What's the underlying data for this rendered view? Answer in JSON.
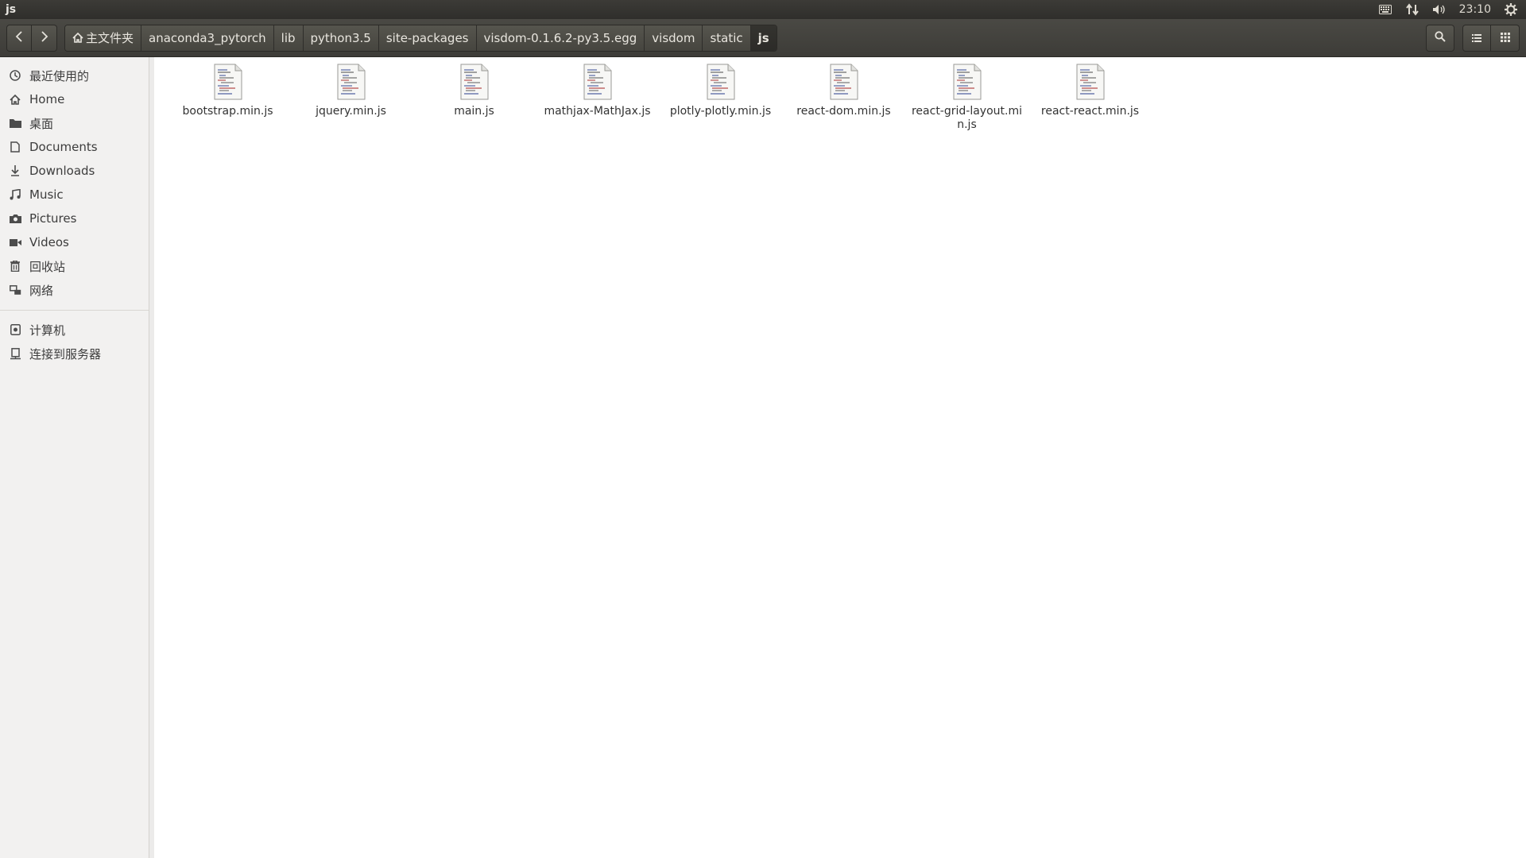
{
  "window": {
    "title": "js"
  },
  "tray": {
    "keyboard_icon": "keyboard-icon",
    "network_icon": "network-arrows-icon",
    "volume_icon": "volume-icon",
    "clock": "23:10",
    "settings_icon": "gear-icon"
  },
  "toolbar": {
    "back_icon": "chevron-left-icon",
    "forward_icon": "chevron-right-icon",
    "breadcrumbs": [
      {
        "label": "主文件夹"
      },
      {
        "label": "anaconda3_pytorch"
      },
      {
        "label": "lib"
      },
      {
        "label": "python3.5"
      },
      {
        "label": "site-packages"
      },
      {
        "label": "visdom-0.1.6.2-py3.5.egg"
      },
      {
        "label": "visdom"
      },
      {
        "label": "static"
      },
      {
        "label": "js"
      }
    ],
    "search_icon": "search-icon",
    "list_view_icon": "list-view-icon",
    "grid_view_icon": "grid-view-icon"
  },
  "sidebar": {
    "items": [
      {
        "label": "最近使用的",
        "icon": "clock-icon"
      },
      {
        "label": "Home",
        "icon": "home-icon"
      },
      {
        "label": "桌面",
        "icon": "folder-icon"
      },
      {
        "label": "Documents",
        "icon": "document-icon"
      },
      {
        "label": "Downloads",
        "icon": "download-icon"
      },
      {
        "label": "Music",
        "icon": "music-icon"
      },
      {
        "label": "Pictures",
        "icon": "camera-icon"
      },
      {
        "label": "Videos",
        "icon": "video-icon"
      },
      {
        "label": "回收站",
        "icon": "trash-icon"
      },
      {
        "label": "网络",
        "icon": "network-icon"
      }
    ],
    "devices": [
      {
        "label": "计算机",
        "icon": "computer-icon"
      },
      {
        "label": "连接到服务器",
        "icon": "server-icon"
      }
    ]
  },
  "files": [
    {
      "name": "bootstrap.min.js"
    },
    {
      "name": "jquery.min.js"
    },
    {
      "name": "main.js"
    },
    {
      "name": "mathjax-MathJax.js"
    },
    {
      "name": "plotly-plotly.min.js"
    },
    {
      "name": "react-dom.min.js"
    },
    {
      "name": "react-grid-layout.min.js"
    },
    {
      "name": "react-react.min.js"
    }
  ]
}
